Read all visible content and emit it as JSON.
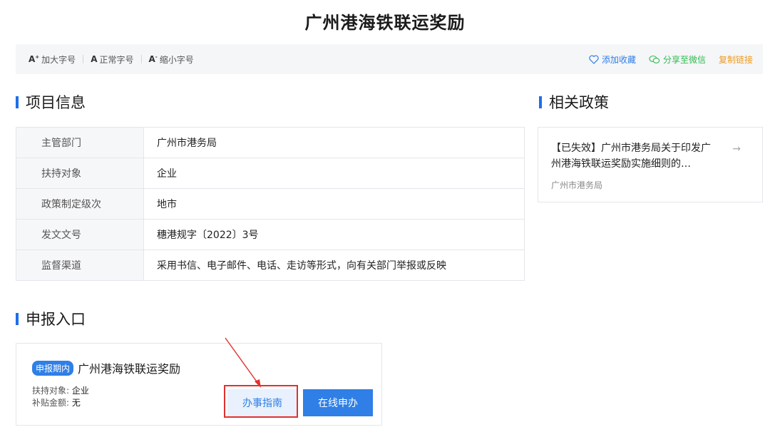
{
  "page": {
    "title": "广州港海铁联运奖励"
  },
  "toolbar": {
    "enlarge_label": "加大字号",
    "normal_label": "正常字号",
    "shrink_label": "缩小字号",
    "favorite_label": "添加收藏",
    "wechat_label": "分享至微信",
    "copy_label": "复制链接"
  },
  "project_info": {
    "heading": "项目信息",
    "rows": [
      {
        "key": "主管部门",
        "value": "广州市港务局"
      },
      {
        "key": "扶持对象",
        "value": "企业"
      },
      {
        "key": "政策制定级次",
        "value": "地市"
      },
      {
        "key": "发文文号",
        "value": "穗港规字〔2022〕3号"
      },
      {
        "key": "监督渠道",
        "value": "采用书信、电子邮件、电话、走访等形式，向有关部门举报或反映"
      }
    ]
  },
  "related": {
    "heading": "相关政策",
    "item_title": "【已失效】广州市港务局关于印发广州港海铁联运奖励实施细则的…",
    "item_source": "广州市港务局"
  },
  "apply": {
    "heading": "申报入口",
    "badge": "申报期内",
    "title": "广州港海铁联运奖励",
    "target_label": "扶持对象:",
    "target_value": "企业",
    "subsidy_label": "补贴金额:",
    "subsidy_value": "无",
    "guide_button": "办事指南",
    "apply_button": "在线申办"
  },
  "colors": {
    "accent": "#2f7fe6",
    "wechat": "#2ebb4e",
    "copy": "#f09a1a",
    "annotation": "#e0312f"
  }
}
